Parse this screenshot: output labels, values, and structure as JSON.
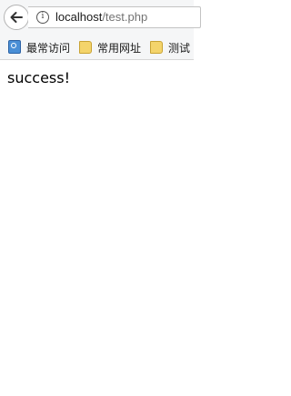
{
  "urlbar": {
    "host": "localhost",
    "path": "/test.php"
  },
  "bookmarks": [
    {
      "label": "最常访问",
      "icon": "most-visited-icon"
    },
    {
      "label": "常用网址",
      "icon": "folder-icon"
    },
    {
      "label": "测试",
      "icon": "folder-icon"
    }
  ],
  "page": {
    "body_text": "success!"
  }
}
